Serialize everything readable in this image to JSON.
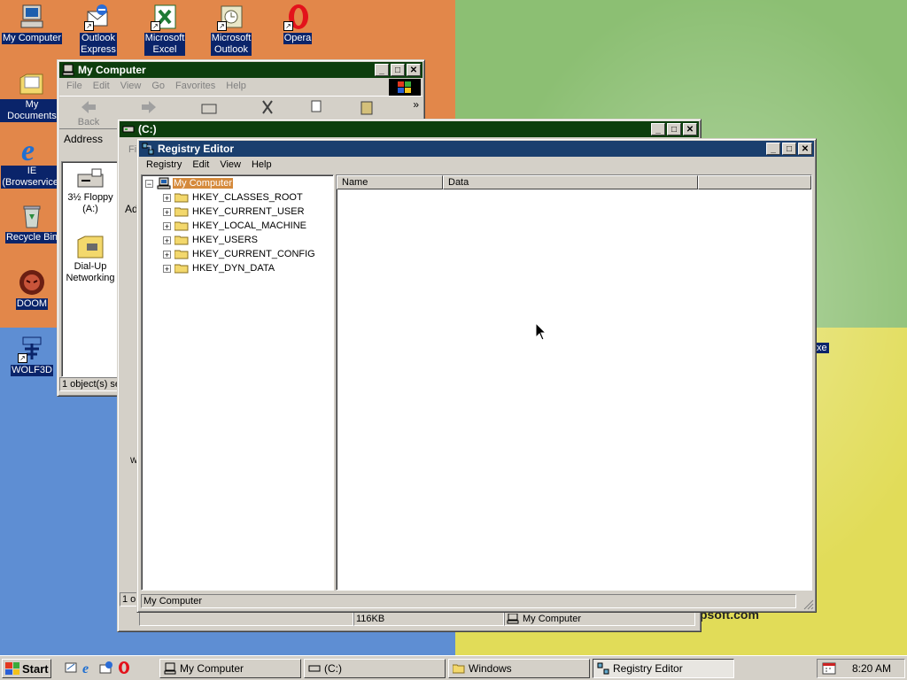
{
  "desktop": {
    "icons": [
      {
        "label": "My Computer",
        "icon": "computer-icon"
      },
      {
        "label": "Outlook Express",
        "line1": "Outlook",
        "line2": "Express",
        "icon": "outlook-express-icon"
      },
      {
        "label": "Microsoft Excel",
        "line1": "Microsoft",
        "line2": "Excel",
        "icon": "excel-icon"
      },
      {
        "label": "Microsoft Outlook",
        "line1": "Microsoft",
        "line2": "Outlook",
        "icon": "outlook-icon"
      },
      {
        "label": "Opera",
        "icon": "opera-icon"
      },
      {
        "label": "My Documents",
        "icon": "documents-folder-icon"
      },
      {
        "label": "IE (Browservice)",
        "line1": "IE",
        "line2": "(Browservice)",
        "icon": "internet-explorer-icon"
      },
      {
        "label": "Recycle Bin",
        "icon": "recycle-bin-icon"
      },
      {
        "label": "DOOM",
        "icon": "doom-icon"
      },
      {
        "label": "WOLF3D",
        "icon": "wolf3d-icon"
      }
    ],
    "wallpaper_text": "psoft.com",
    "partial_icon_text": "xe"
  },
  "my_computer_window": {
    "title": "My Computer",
    "menu": [
      "File",
      "Edit",
      "View",
      "Go",
      "Favorites",
      "Help"
    ],
    "toolbar": {
      "back": "Back"
    },
    "address_label": "Address",
    "items": [
      {
        "line1": "3½ Floppy",
        "line2": "(A:)",
        "icon": "floppy-drive-icon"
      },
      {
        "line1": "Dial-Up",
        "line2": "Networking",
        "icon": "dial-up-networking-icon"
      }
    ],
    "status": "1 object(s) se"
  },
  "c_window": {
    "title": "(C:)",
    "menu_fragment": "Fi",
    "address_fragment": "Ad",
    "side_letter": "W",
    "status_left": "1 ol",
    "status_size": "116KB",
    "status_location": "My Computer"
  },
  "registry_editor": {
    "title": "Registry Editor",
    "menu": [
      "Registry",
      "Edit",
      "View",
      "Help"
    ],
    "tree_root": "My Computer",
    "keys": [
      "HKEY_CLASSES_ROOT",
      "HKEY_CURRENT_USER",
      "HKEY_LOCAL_MACHINE",
      "HKEY_USERS",
      "HKEY_CURRENT_CONFIG",
      "HKEY_DYN_DATA"
    ],
    "columns": [
      "Name",
      "Data"
    ],
    "status": "My Computer"
  },
  "taskbar": {
    "start_label": "Start",
    "tasks": [
      {
        "label": "My Computer",
        "icon": "computer-icon",
        "active": false
      },
      {
        "label": "(C:)",
        "icon": "drive-icon",
        "active": false
      },
      {
        "label": "Windows",
        "icon": "folder-icon",
        "active": false
      },
      {
        "label": "Registry Editor",
        "icon": "registry-editor-icon",
        "active": true
      }
    ],
    "clock": "8:20 AM"
  }
}
